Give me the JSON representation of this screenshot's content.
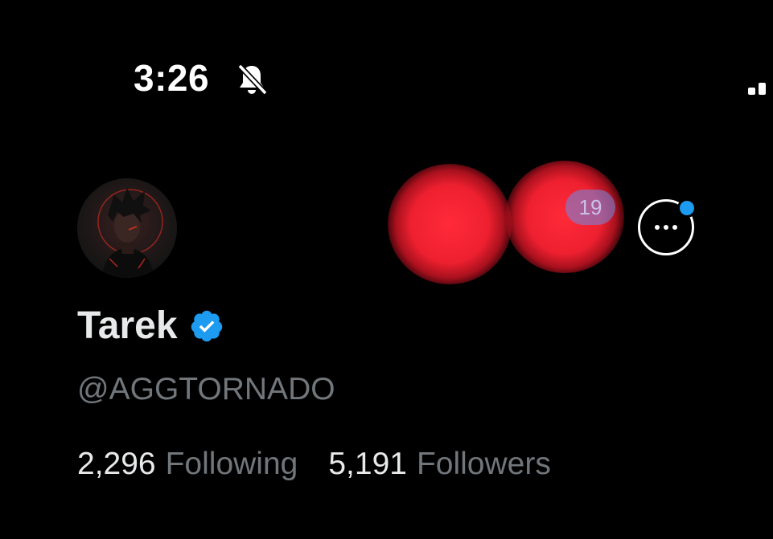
{
  "status_bar": {
    "time": "3:26",
    "silent_icon": "bell-slash-icon",
    "signal_icon": "signal-icon"
  },
  "profile": {
    "avatar": "avatar-anime-character",
    "name": "Tarek",
    "verified_icon": "verified-badge-icon",
    "handle": "@AGGTORNADO",
    "following_count": "2,296",
    "following_label": "Following",
    "followers_count": "5,191",
    "followers_label": "Followers"
  },
  "header_actions": {
    "notification_badge": "19",
    "more_icon": "more-options-icon"
  },
  "colors": {
    "background": "#000000",
    "accent": "#1d9bf0",
    "text_primary": "#e7e9ea",
    "text_secondary": "#71767b",
    "redaction": "#ee2030"
  }
}
